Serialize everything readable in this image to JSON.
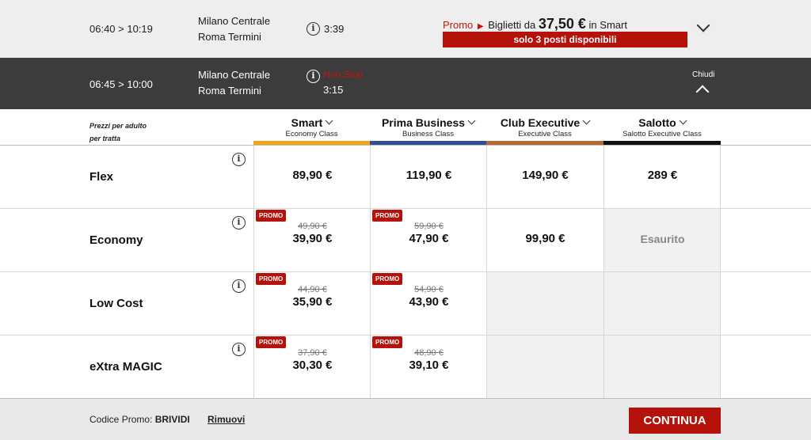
{
  "trains": [
    {
      "times": "06:40 > 10:19",
      "from": "Milano Centrale",
      "to": "Roma Termini",
      "duration": "3:39",
      "promo": {
        "label": "Promo",
        "text_before": "Biglietti da",
        "price": "37,50 €",
        "text_after": "in Smart",
        "availability": "solo 3 posti disponibili"
      }
    },
    {
      "times": "06:45 > 10:00",
      "from": "Milano Centrale",
      "to": "Roma Termini",
      "nonstop": "Non Stop",
      "duration": "3:15",
      "close_label": "Chiudi"
    }
  ],
  "fare_table": {
    "per_adult_line1": "Prezzi per adulto",
    "per_adult_line2": "per tratta",
    "classes": [
      {
        "name": "Smart",
        "sub": "Economy Class",
        "color": "#f2a516"
      },
      {
        "name": "Prima Business",
        "sub": "Business Class",
        "color": "#2f4f8f"
      },
      {
        "name": "Club Executive",
        "sub": "Executive Class",
        "color": "#b46a35"
      },
      {
        "name": "Salotto",
        "sub": "Salotto Executive Class",
        "color": "#111111"
      }
    ],
    "promo_badge": "PROMO",
    "sold_out": "Esaurito",
    "rows": [
      {
        "name": "Flex",
        "cells": [
          {
            "price": "89,90 €"
          },
          {
            "price": "119,90 €"
          },
          {
            "price": "149,90 €"
          },
          {
            "price": "289 €"
          }
        ]
      },
      {
        "name": "Economy",
        "cells": [
          {
            "price": "39,90 €",
            "old": "49,90 €",
            "promo": true
          },
          {
            "price": "47,90 €",
            "old": "59,90 €",
            "promo": true
          },
          {
            "price": "99,90 €"
          },
          {
            "sold": true
          }
        ]
      },
      {
        "name": "Low Cost",
        "cells": [
          {
            "price": "35,90 €",
            "old": "44,90 €",
            "promo": true
          },
          {
            "price": "43,90 €",
            "old": "54,90 €",
            "promo": true
          },
          {
            "empty": true
          },
          {
            "empty": true
          }
        ]
      },
      {
        "name": "eXtra MAGIC",
        "cells": [
          {
            "price": "30,30 €",
            "old": "37,90 €",
            "promo": true
          },
          {
            "price": "39,10 €",
            "old": "48,90 €",
            "promo": true
          },
          {
            "empty": true
          },
          {
            "empty": true
          }
        ]
      }
    ]
  },
  "footer": {
    "promo_code_label": "Codice Promo:",
    "promo_code_value": "BRIVIDI",
    "remove_label": "Rimuovi",
    "continue_label": "CONTINUA"
  }
}
